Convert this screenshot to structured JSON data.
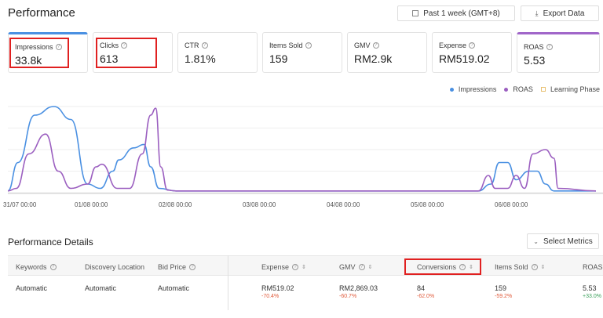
{
  "header": {
    "title": "Performance",
    "date_range": "Past 1 week (GMT+8)",
    "export": "Export Data"
  },
  "metrics": [
    {
      "label": "Impressions",
      "value": "33.8k"
    },
    {
      "label": "Clicks",
      "value": "613"
    },
    {
      "label": "CTR",
      "value": "1.81%"
    },
    {
      "label": "Items Sold",
      "value": "159"
    },
    {
      "label": "GMV",
      "value": "RM2.9k"
    },
    {
      "label": "Expense",
      "value": "RM519.02"
    },
    {
      "label": "ROAS",
      "value": "5.53"
    }
  ],
  "chart_data": {
    "type": "line",
    "legend": [
      "Impressions",
      "ROAS",
      "Learning Phase"
    ],
    "x_ticks": [
      "31/07 00:00",
      "01/08 00:00",
      "02/08 00:00",
      "03/08 00:00",
      "04/08 00:00",
      "05/08 00:00",
      "06/08 00:00"
    ],
    "series": [
      {
        "name": "Impressions",
        "color": "#4a90e2",
        "points": [
          [
            0,
            0.02
          ],
          [
            0.12,
            0.35
          ],
          [
            0.32,
            0.9
          ],
          [
            0.55,
            1.0
          ],
          [
            0.75,
            0.85
          ],
          [
            0.95,
            0.1
          ],
          [
            1.1,
            0.05
          ],
          [
            1.25,
            0.25
          ],
          [
            1.32,
            0.38
          ],
          [
            1.5,
            0.52
          ],
          [
            1.62,
            0.56
          ],
          [
            1.7,
            0.3
          ],
          [
            1.8,
            0.05
          ],
          [
            2.0,
            0.02
          ],
          [
            5.6,
            0.02
          ],
          [
            5.75,
            0.1
          ],
          [
            5.85,
            0.35
          ],
          [
            5.95,
            0.35
          ],
          [
            6.05,
            0.15
          ],
          [
            6.2,
            0.25
          ],
          [
            6.3,
            0.25
          ],
          [
            6.4,
            0.1
          ],
          [
            6.5,
            0.02
          ],
          [
            7,
            0.02
          ]
        ]
      },
      {
        "name": "ROAS",
        "color": "#9b5fc0",
        "points": [
          [
            0,
            0.02
          ],
          [
            0.1,
            0.05
          ],
          [
            0.25,
            0.45
          ],
          [
            0.45,
            0.68
          ],
          [
            0.6,
            0.25
          ],
          [
            0.75,
            0.05
          ],
          [
            0.95,
            0.1
          ],
          [
            1.05,
            0.3
          ],
          [
            1.12,
            0.33
          ],
          [
            1.3,
            0.05
          ],
          [
            1.45,
            0.05
          ],
          [
            1.6,
            0.45
          ],
          [
            1.7,
            0.9
          ],
          [
            1.76,
            0.98
          ],
          [
            1.82,
            0.3
          ],
          [
            1.9,
            0.03
          ],
          [
            2.0,
            0.02
          ],
          [
            5.6,
            0.02
          ],
          [
            5.72,
            0.2
          ],
          [
            5.8,
            0.05
          ],
          [
            5.95,
            0.05
          ],
          [
            6.05,
            0.2
          ],
          [
            6.15,
            0.05
          ],
          [
            6.25,
            0.45
          ],
          [
            6.4,
            0.5
          ],
          [
            6.5,
            0.4
          ],
          [
            6.55,
            0.05
          ],
          [
            7,
            0.02
          ]
        ]
      }
    ]
  },
  "details": {
    "title": "Performance Details",
    "select_metrics": "Select Metrics",
    "columns": [
      "Keywords",
      "Discovery Location",
      "Bid Price",
      "Expense",
      "GMV",
      "Conversions",
      "Items Sold",
      "ROAS"
    ],
    "row": {
      "keyword": "Automatic",
      "location": "Automatic",
      "bid": "Automatic",
      "expense": "RM519.02",
      "expense_change": "-70.4%",
      "gmv": "RM2,869.03",
      "gmv_change": "-60.7%",
      "conversions": "84",
      "conversions_change": "-62.0%",
      "items_sold": "159",
      "items_change": "-59.2%",
      "roas": "5.53",
      "roas_change": "+33.0%"
    }
  }
}
